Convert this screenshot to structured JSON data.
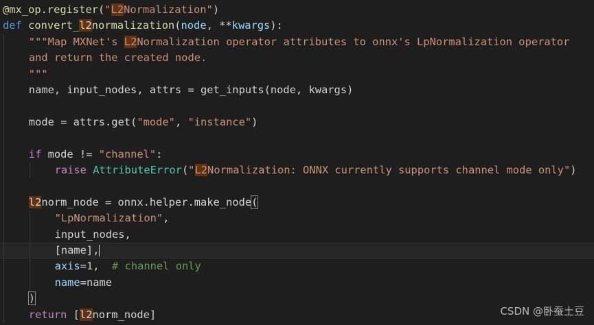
{
  "watermark": "CSDN @卧蚕土豆",
  "code_lines": [
    {
      "indent": 0,
      "tokens": [
        {
          "t": "@mx_op.register(",
          "c": "fn"
        },
        {
          "t": "\"",
          "c": "str"
        },
        {
          "t": "L2",
          "c": "str",
          "hl": true
        },
        {
          "t": "Normalization\"",
          "c": "str"
        },
        {
          "t": ")",
          "c": "plain"
        }
      ]
    },
    {
      "indent": 0,
      "tokens": [
        {
          "t": "def ",
          "c": "kw"
        },
        {
          "t": "convert_",
          "c": "fn"
        },
        {
          "t": "l2",
          "c": "fn",
          "hl": true
        },
        {
          "t": "normalization",
          "c": "fn"
        },
        {
          "t": "(",
          "c": "plain"
        },
        {
          "t": "node",
          "c": "var"
        },
        {
          "t": ", **",
          "c": "plain"
        },
        {
          "t": "kwargs",
          "c": "var"
        },
        {
          "t": "):",
          "c": "plain"
        }
      ]
    },
    {
      "indent": 1,
      "tokens": [
        {
          "t": "\"\"\"Map MXNet's ",
          "c": "str"
        },
        {
          "t": "L2",
          "c": "str",
          "hl": true
        },
        {
          "t": "Normalization operator attributes to onnx's LpNormalization operator",
          "c": "str"
        }
      ]
    },
    {
      "indent": 1,
      "tokens": [
        {
          "t": "and return the created node.",
          "c": "str"
        }
      ]
    },
    {
      "indent": 1,
      "tokens": [
        {
          "t": "\"\"\"",
          "c": "str"
        }
      ]
    },
    {
      "indent": 1,
      "tokens": [
        {
          "t": "name, input_nodes, attrs = get_inputs(node, kwargs)",
          "c": "plain"
        }
      ]
    },
    {
      "indent": 1,
      "tokens": []
    },
    {
      "indent": 1,
      "tokens": [
        {
          "t": "mode = attrs.get(",
          "c": "plain"
        },
        {
          "t": "\"mode\"",
          "c": "str"
        },
        {
          "t": ", ",
          "c": "plain"
        },
        {
          "t": "\"instance\"",
          "c": "str"
        },
        {
          "t": ")",
          "c": "plain"
        }
      ]
    },
    {
      "indent": 1,
      "tokens": []
    },
    {
      "indent": 1,
      "tokens": [
        {
          "t": "if ",
          "c": "kw2"
        },
        {
          "t": "mode != ",
          "c": "plain"
        },
        {
          "t": "\"channel\"",
          "c": "str"
        },
        {
          "t": ":",
          "c": "plain"
        }
      ]
    },
    {
      "indent": 2,
      "tokens": [
        {
          "t": "raise ",
          "c": "kw2"
        },
        {
          "t": "AttributeError",
          "c": "cls"
        },
        {
          "t": "(",
          "c": "plain"
        },
        {
          "t": "\"",
          "c": "str"
        },
        {
          "t": "L2",
          "c": "str",
          "hl": true
        },
        {
          "t": "Normalization: ONNX currently supports channel mode only\"",
          "c": "str"
        },
        {
          "t": ")",
          "c": "plain"
        }
      ]
    },
    {
      "indent": 1,
      "tokens": []
    },
    {
      "indent": 1,
      "tokens": [
        {
          "t": "l2",
          "c": "plain",
          "hl": true
        },
        {
          "t": "norm_node = onnx.helper.make_node",
          "c": "plain"
        },
        {
          "t": "(",
          "c": "plain",
          "brk": true
        }
      ]
    },
    {
      "indent": 2,
      "tokens": [
        {
          "t": "\"LpNormalization\"",
          "c": "str"
        },
        {
          "t": ",",
          "c": "plain"
        }
      ]
    },
    {
      "indent": 2,
      "tokens": [
        {
          "t": "input_nodes,",
          "c": "plain"
        }
      ]
    },
    {
      "indent": 2,
      "current": true,
      "cursor": true,
      "tokens": [
        {
          "t": "[name],",
          "c": "plain"
        }
      ]
    },
    {
      "indent": 2,
      "tokens": [
        {
          "t": "axis",
          "c": "var"
        },
        {
          "t": "=",
          "c": "plain"
        },
        {
          "t": "1",
          "c": "num"
        },
        {
          "t": ",  ",
          "c": "plain"
        },
        {
          "t": "# channel only",
          "c": "cmt"
        }
      ]
    },
    {
      "indent": 2,
      "tokens": [
        {
          "t": "name",
          "c": "var"
        },
        {
          "t": "=name",
          "c": "plain"
        }
      ]
    },
    {
      "indent": 1,
      "tokens": [
        {
          "t": ")",
          "c": "plain",
          "brk": true
        }
      ]
    },
    {
      "indent": 1,
      "tokens": [
        {
          "t": "return ",
          "c": "kw2"
        },
        {
          "t": "[",
          "c": "plain"
        },
        {
          "t": "l2",
          "c": "plain",
          "hl": true
        },
        {
          "t": "norm_node]",
          "c": "plain"
        }
      ]
    }
  ]
}
